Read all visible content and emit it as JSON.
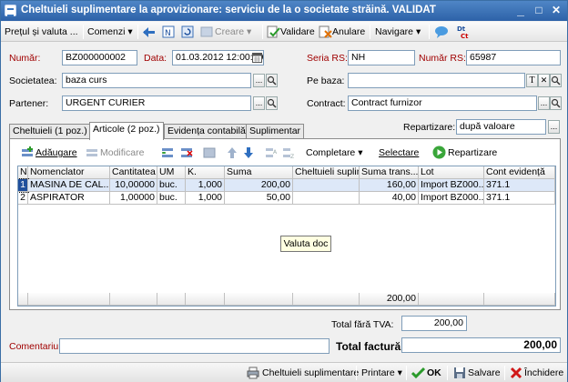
{
  "window": {
    "title": "Cheltuieli suplimentare la aprovizionare: serviciu de la o societate străină. VALIDAT",
    "min": "_",
    "max": "□",
    "close": "✕"
  },
  "toolbar": {
    "pret": "Prețul și valuta ...",
    "comenzi": "Comenzi ▾",
    "creare": "Creare ▾",
    "validare": "Validare",
    "anulare": "Anulare",
    "navigare": "Navigare ▾"
  },
  "form": {
    "numar_label": "Număr:",
    "numar": "BZ000000002",
    "data_label": "Data:",
    "data": "01.03.2012 12:00:00",
    "seria_label": "Seria RS:",
    "seria": "NH",
    "numar_rs_label": "Număr RS:",
    "numar_rs": "65987",
    "societatea_label": "Societatea:",
    "societatea": "baza curs",
    "pe_baza_label": "Pe baza:",
    "pe_baza": "",
    "partener_label": "Partener:",
    "partener": "URGENT CURIER",
    "contract_label": "Contract:",
    "contract": "Contract furnizor",
    "repartizare_label": "Repartizare:",
    "repartizare": "după valoare"
  },
  "tabs": [
    "Cheltuieli (1 poz.)",
    "Articole (2 poz.)",
    "Evidența contabilă",
    "Suplimentar"
  ],
  "gridtoolbar": {
    "adaugare": "Adăugare",
    "modificare": "Modificare",
    "completare": "Completare ▾",
    "selectare": "Selectare",
    "repartizare": "Repartizare"
  },
  "grid": {
    "headers": [
      "Nr.",
      "Nomenclator",
      "Cantitatea",
      "UM",
      "K.",
      "Suma",
      "Cheltuieli suplim.",
      "Suma trans...",
      "Lot",
      "Cont evidență"
    ],
    "rows": [
      [
        "1",
        "MASINA DE CAL...",
        "10,00000",
        "buc.",
        "1,000",
        "200,00",
        "",
        "160,00",
        "Import BZ000...",
        "371.1"
      ],
      [
        "2",
        "ASPIRATOR",
        "1,00000",
        "buc.",
        "1,000",
        "50,00",
        "",
        "40,00",
        "Import BZ000...",
        "371.1"
      ]
    ],
    "footer_total": "200,00"
  },
  "tooltip": "Valuta doc",
  "totals": {
    "fara_tva_label": "Total fără TVA:",
    "fara_tva": "200,00",
    "factura_label": "Total factură:",
    "factura": "200,00",
    "comentariu_label": "Comentariu:",
    "comentariu": ""
  },
  "bottom": {
    "cheltuieli": "Cheltuieli suplimentare",
    "printare": "Printare ▾",
    "ok": "OK",
    "salvare": "Salvare",
    "inchidere": "Închidere"
  }
}
